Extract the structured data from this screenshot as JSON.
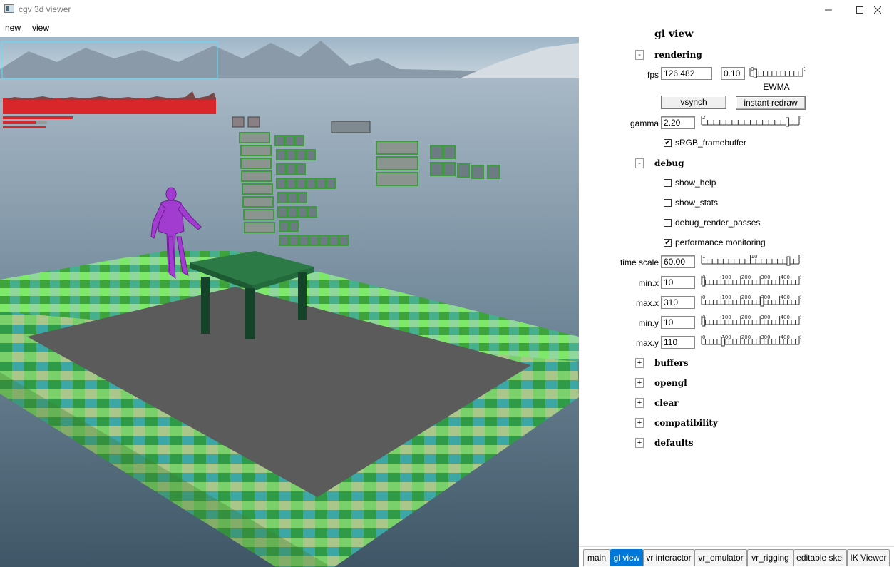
{
  "window": {
    "title": "cgv 3d viewer"
  },
  "menu": {
    "items": [
      "new",
      "view"
    ]
  },
  "panel": {
    "title": "gl view",
    "rendering": {
      "toggle": "-",
      "label": "rendering",
      "fps_label": "fps",
      "fps_value": "126.482",
      "ewma_value": "0.10",
      "ewma_label": "EWMA",
      "ewma_ticks": [
        "0",
        "1"
      ],
      "vsynch_label": "vsynch",
      "instant_redraw_label": "instant redraw",
      "gamma_label": "gamma",
      "gamma_value": "2.20",
      "gamma_ticks": [
        "2",
        "5"
      ],
      "srgb_label": "sRGB_framebuffer",
      "srgb_checked": true
    },
    "debug": {
      "toggle": "-",
      "label": "debug",
      "show_help_label": "show_help",
      "show_help_checked": false,
      "show_stats_label": "show_stats",
      "show_stats_checked": false,
      "debug_render_passes_label": "debug_render_passes",
      "debug_render_passes_checked": false,
      "perf_label": "performance monitoring",
      "perf_checked": true,
      "time_scale_label": "time scale",
      "time_scale_value": "60.00",
      "time_scale_ticks": [
        "1",
        "10",
        "100"
      ],
      "minx_label": "min.x",
      "minx_value": "10",
      "maxx_label": "max.x",
      "maxx_value": "310",
      "miny_label": "min.y",
      "miny_value": "10",
      "maxy_label": "max.y",
      "maxy_value": "110",
      "range_ticks": [
        "0",
        "100",
        "200",
        "300",
        "400",
        "500"
      ]
    },
    "sections": [
      {
        "toggle": "+",
        "label": "buffers"
      },
      {
        "toggle": "+",
        "label": "opengl"
      },
      {
        "toggle": "+",
        "label": "clear"
      },
      {
        "toggle": "+",
        "label": "compatibility"
      },
      {
        "toggle": "+",
        "label": "defaults"
      }
    ]
  },
  "tabs": [
    "main",
    "gl view",
    "vr interactor",
    "vr_emulator",
    "vr_rigging",
    "editable skel",
    "IK Viewer"
  ],
  "active_tab": "gl view"
}
